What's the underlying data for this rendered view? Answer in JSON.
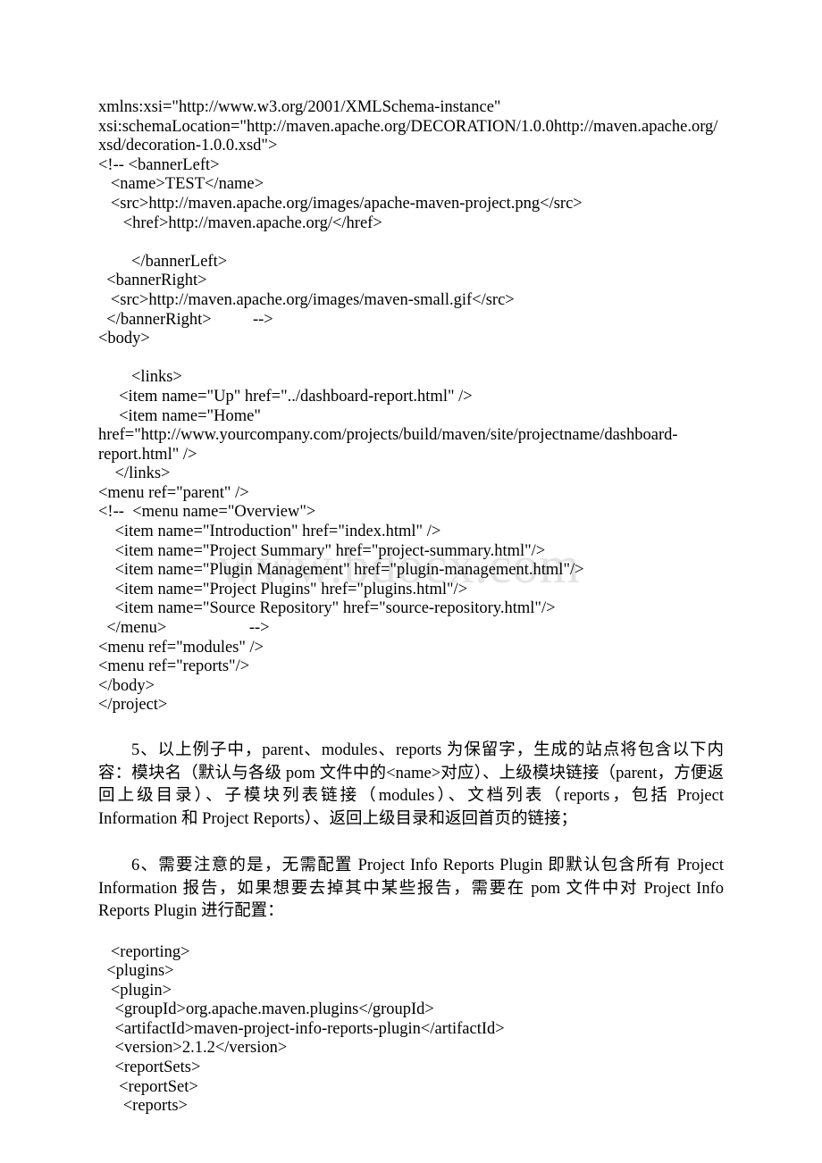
{
  "document": {
    "watermark": "www.bdocx.com",
    "blocks": [
      {
        "type": "code",
        "name": "site-descriptor-xml",
        "lines": [
          "xmlns:xsi=\"http://www.w3.org/2001/XMLSchema-instance\"",
          "xsi:schemaLocation=\"http://maven.apache.org/DECORATION/1.0.0http://maven.apache.org/xsd/decoration-1.0.0.xsd\">",
          "<!-- <bannerLeft>",
          "   <name>TEST</name>",
          "   <src>http://maven.apache.org/images/apache-maven-project.png</src>",
          "      <href>http://maven.apache.org/</href>",
          "",
          "        </bannerLeft>",
          "  <bannerRight>",
          "   <src>http://maven.apache.org/images/maven-small.gif</src>",
          "  </bannerRight>          -->",
          "<body>",
          "",
          "        <links>",
          "     <item name=\"Up\" href=\"../dashboard-report.html\" />",
          "     <item name=\"Home\" href=\"http://www.yourcompany.com/projects/build/maven/site/projectname/dashboard-report.html\" />",
          "    </links>",
          "<menu ref=\"parent\" />",
          "<!--  <menu name=\"Overview\">",
          "    <item name=\"Introduction\" href=\"index.html\" />",
          "    <item name=\"Project Summary\" href=\"project-summary.html\"/>",
          "    <item name=\"Plugin Management\" href=\"plugin-management.html\"/>",
          "    <item name=\"Project Plugins\" href=\"plugins.html\"/>",
          "    <item name=\"Source Repository\" href=\"source-repository.html\"/>",
          "  </menu>                    -->",
          "<menu ref=\"modules\" />",
          "<menu ref=\"reports\"/>",
          "</body>",
          "</project>"
        ],
        "wrap_line_indices": [
          1,
          15
        ]
      },
      {
        "type": "paragraph",
        "name": "paragraph-5",
        "text": "5、以上例子中，parent、modules、reports 为保留字，生成的站点将包含以下内容：模块名（默认与各级 pom 文件中的<name>对应）、上级模块链接（parent，方便返回上级目录）、子模块列表链接（modules）、文档列表（reports，包括 Project Information 和 Project Reports）、返回上级目录和返回首页的链接；"
      },
      {
        "type": "paragraph",
        "name": "paragraph-6",
        "text": "6、需要注意的是，无需配置 Project Info Reports Plugin 即默认包含所有 Project Information 报告，如果想要去掉其中某些报告，需要在 pom 文件中对 Project Info Reports Plugin 进行配置："
      },
      {
        "type": "code",
        "name": "reporting-plugin-xml",
        "lines": [
          "   <reporting>",
          "  <plugins>",
          "   <plugin>",
          "    <groupId>org.apache.maven.plugins</groupId>",
          "    <artifactId>maven-project-info-reports-plugin</artifactId>",
          "    <version>2.1.2</version>",
          "    <reportSets>",
          "     <reportSet>",
          "      <reports>"
        ],
        "wrap_line_indices": []
      }
    ]
  }
}
